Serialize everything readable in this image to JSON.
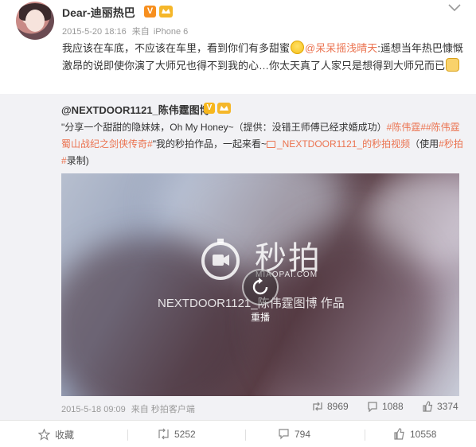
{
  "post": {
    "user": {
      "name": "Dear-迪丽热巴",
      "verified_badge": "V",
      "level_badge": "会员"
    },
    "time": "2015-5-20 18:16",
    "from_label": "来自",
    "device": "iPhone 6",
    "text_parts": {
      "p1": "我应该在车底，不应该在车里，看到你们有多甜蜜",
      "mention": "@呆呆摇浅晴天",
      "p2": ":遥想当年热巴慷慨激昂的说即使你演了大师兄也得不到我的心…你太天真了人家只是想得到大师兄而已"
    },
    "emojis": [
      "smile-emoji",
      "cat-emoji"
    ]
  },
  "quote": {
    "user": {
      "name": "@NEXTDOOR1121_陈伟霆图博",
      "verified_badge": "V",
      "level_badge": "会员"
    },
    "text_parts": {
      "p1": "\"分享一个甜甜的隐妹妹，Oh My Honey~（提供：没错王师傅已经求婚成功）",
      "tag1": "#陈伟霆#",
      "tag2": "#陈伟霆蜀山战纪之剑侠传奇#",
      "p2": "\"我的秒拍作品，一起来看~",
      "video_link": "_NEXTDOOR1121_的秒拍视频",
      "p3": "（使用",
      "tag3": "#秒拍#",
      "p4": "录制)"
    },
    "video": {
      "brand": "秒拍",
      "domain": "MIAOPAI.COM",
      "credit": "NEXTDOOR1121_陈伟霆图博 作品",
      "replay_label": "重播"
    },
    "time": "2015-5-18 09:09",
    "from_label": "来自",
    "client": "秒拍客户端",
    "stats": {
      "reposts": "8969",
      "comments": "1088",
      "likes": "3374"
    }
  },
  "actions": {
    "favorite": "收藏",
    "repost": "5252",
    "comment": "794",
    "like": "10558"
  },
  "colors": {
    "accent": "#eb7350",
    "badge_orange": "#f78f1e",
    "quote_bg": "#f2f2f5"
  }
}
